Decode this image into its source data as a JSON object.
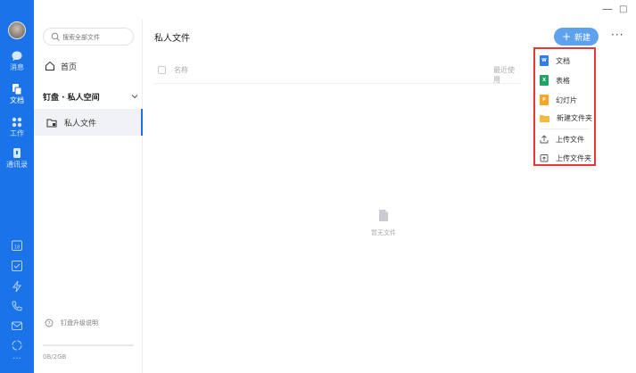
{
  "rail": {
    "items": [
      {
        "label": "消息",
        "icon": "chat-bubble-icon"
      },
      {
        "label": "文档",
        "icon": "document-icon"
      },
      {
        "label": "工作",
        "icon": "grid-icon"
      },
      {
        "label": "通讯录",
        "icon": "contacts-icon"
      }
    ],
    "bottom_tools": [
      "calendar-icon",
      "todo-check-icon",
      "lightning-icon",
      "phone-icon",
      "mail-icon",
      "recycle-icon",
      "more-dots-icon"
    ],
    "calendar_day": "18",
    "more_dots": "···"
  },
  "window": {
    "minimize": "—",
    "maximize": "□",
    "close": "×"
  },
  "nav": {
    "search_placeholder": "搜索全部文件",
    "home_label": "首页",
    "section_label": "钉盘 · 私人空间",
    "active_item": "私人文件",
    "help_label": "钉盘升级说明",
    "quota_text": "0B/2GB",
    "quota_fraction": 0
  },
  "main": {
    "title": "私人文件",
    "new_button": "新建",
    "new_plus": "+",
    "more": "···",
    "columns": {
      "name": "名称",
      "recent": "最近使用"
    },
    "empty_text": "暂无文件"
  },
  "menu": {
    "items": [
      {
        "label": "文档",
        "icon": "doc-file-icon",
        "color": "#2f7cf6",
        "glyph": "W"
      },
      {
        "label": "表格",
        "icon": "sheet-file-icon",
        "color": "#21a366",
        "glyph": "X"
      },
      {
        "label": "幻灯片",
        "icon": "slides-file-icon",
        "color": "#f5a623",
        "glyph": "P"
      },
      {
        "label": "新建文件夹",
        "icon": "folder-icon",
        "color": "#f6b93b"
      },
      {
        "label": "上传文件",
        "icon": "upload-file-icon"
      },
      {
        "label": "上传文件夹",
        "icon": "upload-folder-icon"
      }
    ],
    "highlight_color": "#e53935"
  },
  "colors": {
    "rail": "#1a73e8",
    "accent": "#5ea2ef"
  }
}
